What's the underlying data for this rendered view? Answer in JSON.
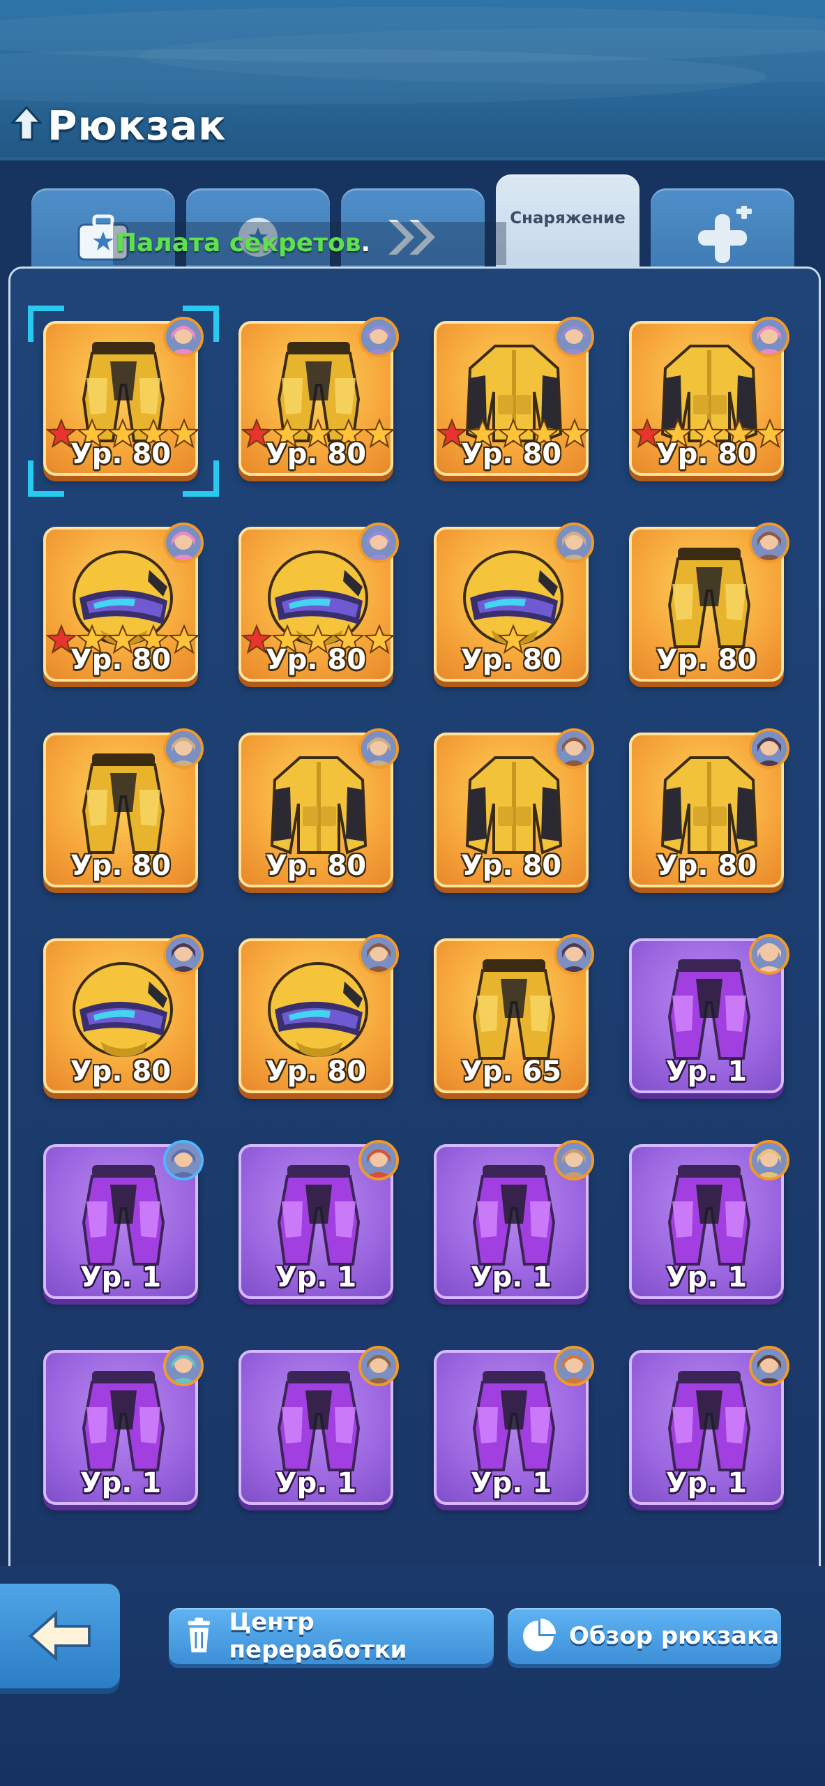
{
  "header": {
    "title": "Рюкзак"
  },
  "tabs": [
    {
      "id": "chests",
      "label": "",
      "icon": "briefcase-star-icon",
      "active": false
    },
    {
      "id": "fragments",
      "label": "",
      "icon": "puzzle-icon",
      "active": false
    },
    {
      "id": "boosts",
      "label": "",
      "icon": "double-chevron-icon",
      "active": false
    },
    {
      "id": "equipment",
      "label": "Снаряжение",
      "icon": "",
      "active": true
    },
    {
      "id": "upgrades",
      "label": "",
      "icon": "plus-icon",
      "active": false
    }
  ],
  "notice": {
    "text": "Палата секретов",
    "suffix": "."
  },
  "items": [
    {
      "type": "pants",
      "rarity": "gold",
      "level": "Ур. 80",
      "stars": 5,
      "red_stars": 1,
      "avatar": "pink-hair-avatar",
      "selected": true
    },
    {
      "type": "pants",
      "rarity": "gold",
      "level": "Ур. 80",
      "stars": 5,
      "red_stars": 1,
      "avatar": "purple-hair-avatar"
    },
    {
      "type": "jacket",
      "rarity": "gold",
      "level": "Ур. 80",
      "stars": 5,
      "red_stars": 1,
      "avatar": "purple-hair-avatar"
    },
    {
      "type": "jacket",
      "rarity": "gold",
      "level": "Ур. 80",
      "stars": 5,
      "red_stars": 1,
      "avatar": "pink-hair-avatar"
    },
    {
      "type": "helmet",
      "rarity": "gold",
      "level": "Ур. 80",
      "stars": 5,
      "red_stars": 1,
      "avatar": "pink-hair-avatar"
    },
    {
      "type": "helmet",
      "rarity": "gold",
      "level": "Ур. 80",
      "stars": 5,
      "red_stars": 1,
      "avatar": "purple-hair-avatar"
    },
    {
      "type": "helmet",
      "rarity": "gold",
      "level": "Ур. 80",
      "stars": 1,
      "red_stars": 0,
      "avatar": "cap-man-avatar"
    },
    {
      "type": "pants",
      "rarity": "gold",
      "level": "Ур. 80",
      "stars": 0,
      "red_stars": 0,
      "avatar": "bear-avatar"
    },
    {
      "type": "pants",
      "rarity": "gold",
      "level": "Ур. 80",
      "stars": 0,
      "red_stars": 0,
      "avatar": "cap-man-avatar"
    },
    {
      "type": "jacket",
      "rarity": "gold",
      "level": "Ур. 80",
      "stars": 0,
      "red_stars": 0,
      "avatar": "cap-man-avatar"
    },
    {
      "type": "jacket",
      "rarity": "gold",
      "level": "Ур. 80",
      "stars": 0,
      "red_stars": 0,
      "avatar": "bear-avatar"
    },
    {
      "type": "jacket",
      "rarity": "gold",
      "level": "Ур. 80",
      "stars": 0,
      "red_stars": 0,
      "avatar": "dark-hair-avatar"
    },
    {
      "type": "helmet",
      "rarity": "gold",
      "level": "Ур. 80",
      "stars": 0,
      "red_stars": 0,
      "avatar": "dark-hair-avatar"
    },
    {
      "type": "helmet",
      "rarity": "gold",
      "level": "Ур. 80",
      "stars": 0,
      "red_stars": 0,
      "avatar": "bear-avatar"
    },
    {
      "type": "pants",
      "rarity": "gold",
      "level": "Ур. 65",
      "stars": 0,
      "red_stars": 0,
      "avatar": "dark-hair-avatar"
    },
    {
      "type": "pants",
      "rarity": "purple",
      "level": "Ур. 1",
      "stars": 0,
      "red_stars": 0,
      "avatar": "nurse-avatar"
    },
    {
      "type": "pants",
      "rarity": "purple",
      "level": "Ур. 1",
      "stars": 0,
      "red_stars": 0,
      "avatar": "hooded-avatar",
      "avatar_border": "blue"
    },
    {
      "type": "pants",
      "rarity": "purple",
      "level": "Ур. 1",
      "stars": 0,
      "red_stars": 0,
      "avatar": "red-hair-avatar"
    },
    {
      "type": "pants",
      "rarity": "purple",
      "level": "Ур. 1",
      "stars": 0,
      "red_stars": 0,
      "avatar": "goggles-avatar"
    },
    {
      "type": "pants",
      "rarity": "purple",
      "level": "Ур. 1",
      "stars": 0,
      "red_stars": 0,
      "avatar": "blonde-avatar"
    },
    {
      "type": "pants",
      "rarity": "purple",
      "level": "Ур. 1",
      "stars": 0,
      "red_stars": 0,
      "avatar": "teal-hair-avatar"
    },
    {
      "type": "pants",
      "rarity": "purple",
      "level": "Ур. 1",
      "stars": 0,
      "red_stars": 0,
      "avatar": "brown-hair-avatar"
    },
    {
      "type": "pants",
      "rarity": "purple",
      "level": "Ур. 1",
      "stars": 0,
      "red_stars": 0,
      "avatar": "pirate-avatar"
    },
    {
      "type": "pants",
      "rarity": "purple",
      "level": "Ур. 1",
      "stars": 0,
      "red_stars": 0,
      "avatar": "dark-man-avatar"
    }
  ],
  "footer": {
    "back_icon": "back-arrow-icon",
    "recycle_label": "Центр переработки",
    "recycle_icon": "trash-icon",
    "overview_label": "Обзор рюкзака",
    "overview_icon": "pie-chart-icon"
  },
  "colors": {
    "gold_card": "#f6a63b",
    "purple_card": "#9b66e0",
    "notice_green": "#5ee14d",
    "selection_cyan": "#29c9f0",
    "accent_button": "#3d8fd6"
  }
}
